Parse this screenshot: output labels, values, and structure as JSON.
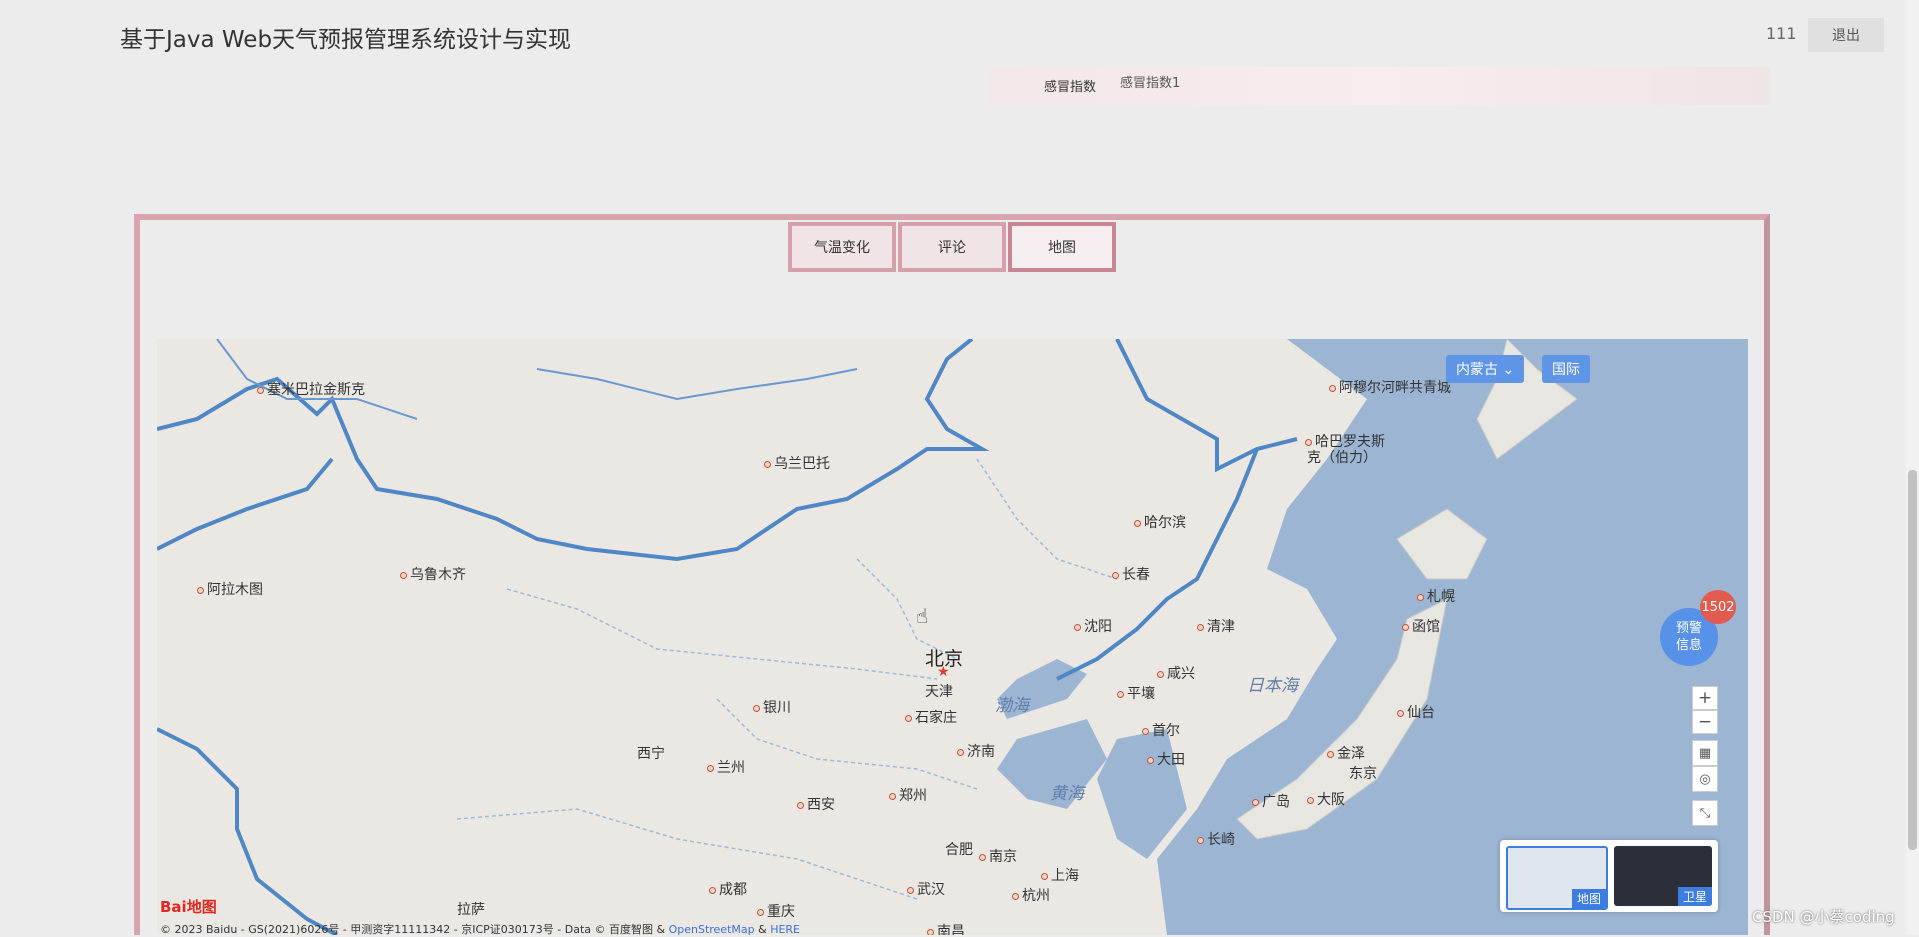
{
  "header": {
    "title": "基于Java Web天气预报管理系统设计与实现",
    "user": "111",
    "logout_label": "退出"
  },
  "cold_index": {
    "label": "感冒指数",
    "value": "感冒指数1"
  },
  "tabs": [
    {
      "label": "气温变化"
    },
    {
      "label": "评论"
    },
    {
      "label": "地图"
    }
  ],
  "map": {
    "region_select": "内蒙古",
    "international_label": "国际",
    "capital": "北京",
    "cities": {
      "c1": "塞米巴拉金斯克",
      "c2": "乌兰巴托",
      "c3": "阿穆尔河畔共青城",
      "c4": "哈巴罗夫斯",
      "c4b": "克（伯力）",
      "c5": "哈尔滨",
      "c6": "乌鲁木齐",
      "c7": "阿拉木图",
      "c8": "长春",
      "c9": "札幌",
      "c10": "沈阳",
      "c11": "清津",
      "c12": "函馆",
      "c13": "咸兴",
      "c14": "天津",
      "c15": "银川",
      "c16": "石家庄",
      "c17": "平壤",
      "c18": "仙台",
      "c19": "西宁",
      "c20": "兰州",
      "c21": "济南",
      "c22": "首尔",
      "c23": "大田",
      "c24": "金泽",
      "c25": "东京",
      "c26": "西安",
      "c27": "郑州",
      "c28": "广岛",
      "c29": "大阪",
      "c30": "合肥",
      "c31": "南京",
      "c32": "上海",
      "c33": "长崎",
      "c34": "成都",
      "c35": "武汉",
      "c36": "杭州",
      "c37": "拉萨",
      "c38": "重庆",
      "c39": "南昌"
    },
    "seas": {
      "s1": "日本海",
      "s2": "渤海",
      "s3": "黄海"
    },
    "alert": {
      "count": "1502",
      "line1": "预警",
      "line2": "信息"
    },
    "zoom_in": "+",
    "zoom_out": "−",
    "map_type_label": "地图",
    "satellite_label": "卫星",
    "copyright_prefix": "© 2023 Baidu - GS(2021)6026号 - 甲测资字11111342 - 京ICP证030173号 - Data © 百度智图 & ",
    "osm_link": "OpenStreetMap",
    "amp": " & ",
    "here_link": "HERE",
    "logo": "Bai地图"
  },
  "watermark": "CSDN @小蔡coding",
  "colors": {
    "tab_border": "#d6a0aa",
    "panel_border": "#d8a4ae",
    "accent": "#5f95e6",
    "alert_badge": "#e35b4f"
  }
}
